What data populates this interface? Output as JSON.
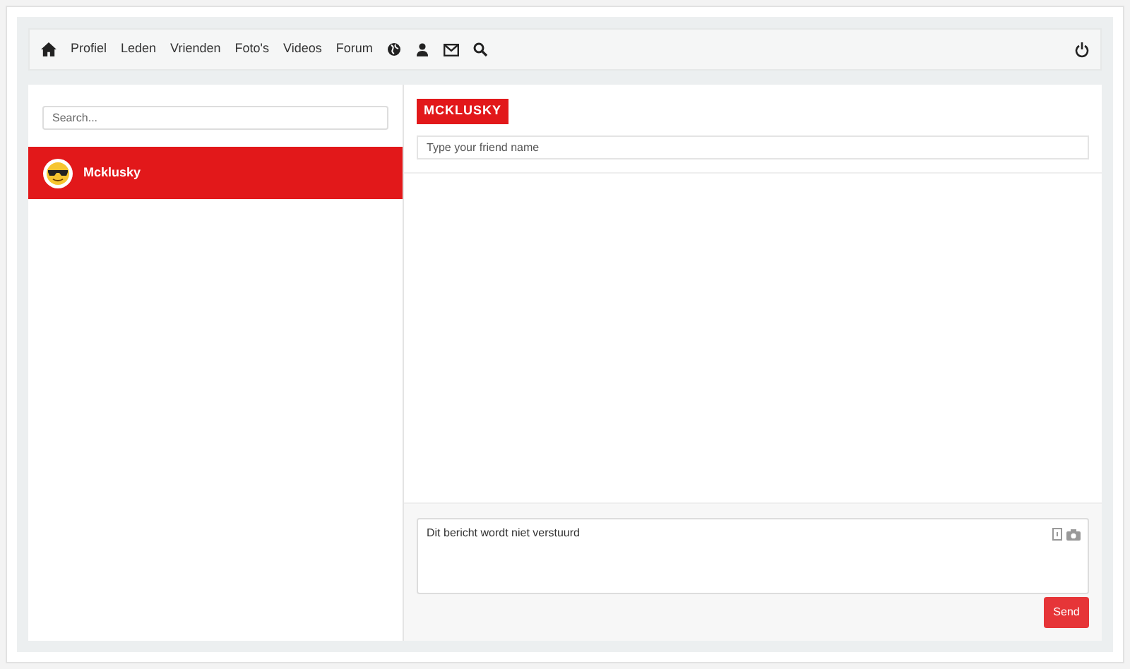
{
  "nav": {
    "items": [
      {
        "label": "Profiel"
      },
      {
        "label": "Leden"
      },
      {
        "label": "Vrienden"
      },
      {
        "label": "Foto's"
      },
      {
        "label": "Videos"
      },
      {
        "label": "Forum"
      }
    ]
  },
  "sidebar": {
    "search": {
      "placeholder": "Search..."
    },
    "contacts": [
      {
        "name": "Mcklusky",
        "selected": true
      }
    ]
  },
  "chat": {
    "title": "MCKLUSKY",
    "friend_field": {
      "placeholder": "Type your friend name"
    },
    "message_field": {
      "value": "Dit bericht wordt niet verstuurd"
    },
    "send_button": "Send"
  }
}
